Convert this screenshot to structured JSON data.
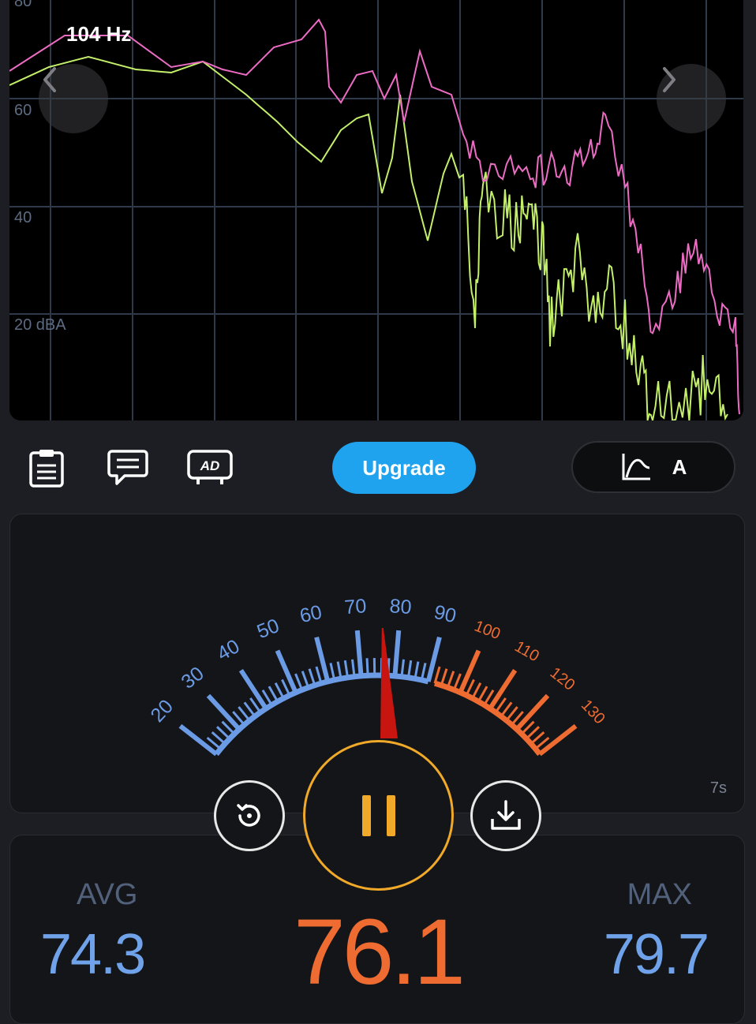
{
  "spectrum": {
    "frequency_label": "104 Hz",
    "y_tick_labels": [
      "80",
      "60",
      "40",
      "20 dBA"
    ],
    "colors": {
      "live_line": "#ec6cc4",
      "avg_line": "#c3ef6a",
      "grid": "#2e3a4a"
    }
  },
  "toolbar": {
    "icons": [
      "clipboard-icon",
      "chat-icon",
      "ad-icon"
    ],
    "upgrade_label": "Upgrade",
    "weighting_label": "A",
    "weighting_icon": "curve-chart-icon"
  },
  "meter": {
    "scale_low": [
      "20",
      "30",
      "40",
      "50",
      "60",
      "70",
      "80",
      "90"
    ],
    "scale_high": [
      "100",
      "110",
      "120",
      "130"
    ],
    "needle_value": 76.1,
    "scale_min": 20,
    "scale_max": 130,
    "elapsed": "7s",
    "colors": {
      "low": "#6c9be6",
      "high": "#ee6c32",
      "needle": "#c8150f"
    }
  },
  "controls": {
    "reset_icon": "reset-icon",
    "pause_icon": "pause-icon",
    "save_icon": "download-icon"
  },
  "stats": {
    "avg_label": "AVG",
    "avg_value": "74.3",
    "current_value": "76.1",
    "max_label": "MAX",
    "max_value": "79.7"
  }
}
